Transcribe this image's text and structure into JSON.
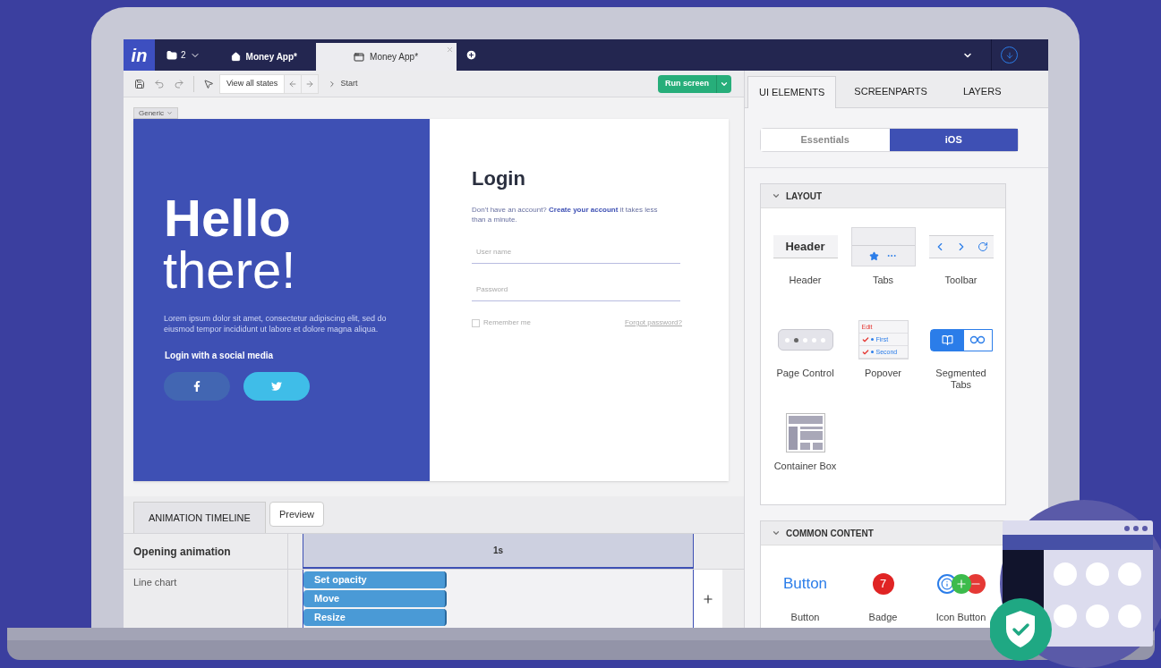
{
  "top_bar": {
    "logo": "in",
    "folder_count": "2",
    "tabs": [
      {
        "kind": "home",
        "label": "Money App*",
        "selected": false
      },
      {
        "kind": "screen",
        "label": "Money App*",
        "selected": true
      }
    ]
  },
  "toolbar": {
    "view_states": "View all states",
    "breadcrumb": "Start",
    "run_button": "Run screen"
  },
  "canvas": {
    "device_tag": "Generic",
    "hello": "Hello",
    "there": "there!",
    "lorem": "Lorem ipsum dolor sit amet, consectetur adipiscing elit, sed do eiusmod tempor incididunt ut labore et dolore magna aliqua.",
    "social_label": "Login with a social media",
    "login_title": "Login",
    "signup_prefix": "Don't have an account?",
    "signup_link": "Create your account",
    "signup_suffix": "it takes less than a minute.",
    "username_placeholder": "User name",
    "password_placeholder": "Password",
    "remember": {
      "label": "Remember me",
      "checked": false
    },
    "forgot_link": "Forgot password?"
  },
  "timeline": {
    "tabs": [
      {
        "label": "ANIMATION TIMELINE",
        "selected": true
      },
      {
        "label": "Preview",
        "selected": false
      }
    ],
    "title": "Opening animation",
    "tick_label": "1s",
    "rows": [
      {
        "label": "Line chart",
        "actions": [
          "Set opacity",
          "Move",
          "Resize"
        ]
      }
    ]
  },
  "panel": {
    "tabs": [
      {
        "label": "UI ELEMENTS",
        "selected": true
      },
      {
        "label": "SCREENPARTS",
        "selected": false
      },
      {
        "label": "LAYERS",
        "selected": false
      }
    ],
    "segments": [
      {
        "label": "Essentials",
        "selected": false
      },
      {
        "label": "iOS",
        "selected": true
      }
    ],
    "sections": [
      {
        "title": "LAYOUT",
        "expanded": true,
        "items": [
          {
            "kind": "header",
            "label": "Header",
            "preview_text": "Header"
          },
          {
            "kind": "tabs",
            "label": "Tabs"
          },
          {
            "kind": "toolbar",
            "label": "Toolbar"
          },
          {
            "kind": "page_control",
            "label": "Page Control"
          },
          {
            "kind": "popover",
            "label": "Popover",
            "preview_lines": [
              "Edit",
              "First",
              "Second"
            ]
          },
          {
            "kind": "segmented_tabs",
            "label": "Segmented Tabs"
          },
          {
            "kind": "container_box",
            "label": "Container Box"
          }
        ]
      },
      {
        "title": "COMMON CONTENT",
        "expanded": true,
        "items": [
          {
            "kind": "button",
            "label": "Button",
            "preview_text": "Button"
          },
          {
            "kind": "badge",
            "label": "Badge",
            "preview_text": "7"
          },
          {
            "kind": "icon_button",
            "label": "Icon Button"
          }
        ]
      }
    ]
  }
}
